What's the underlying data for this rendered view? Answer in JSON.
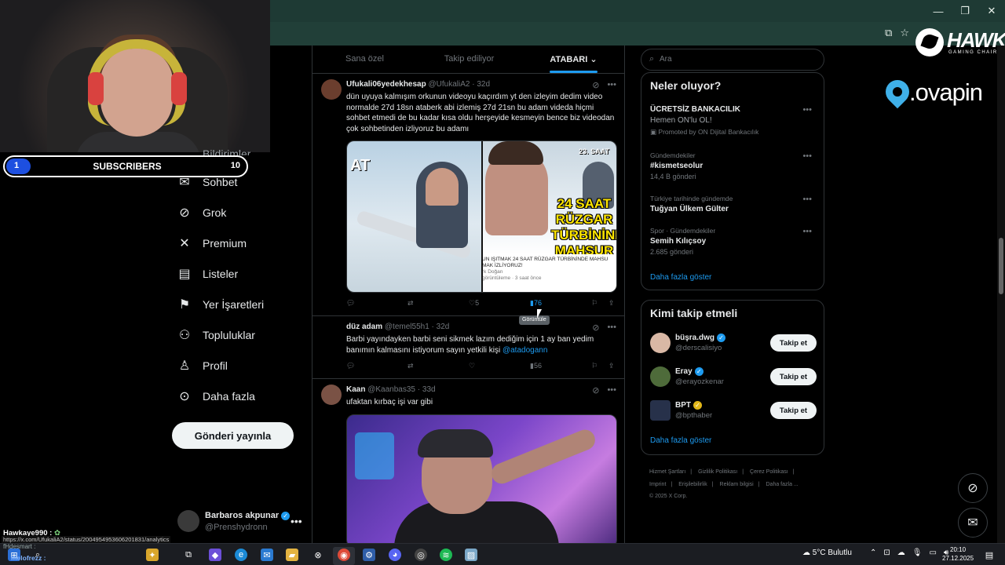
{
  "window": {
    "minimize": "—",
    "maximize": "❐",
    "close": "✕"
  },
  "subs": {
    "current": "1",
    "label": "SUBSCRIBERS",
    "goal": "10",
    "progress": 0.1
  },
  "nav": {
    "cut_item": "Bildirimler",
    "items": [
      {
        "label": "Sohbet",
        "icon": "chat-icon"
      },
      {
        "label": "Grok",
        "icon": "grok-icon"
      },
      {
        "label": "Premium",
        "icon": "x-logo-icon"
      },
      {
        "label": "Listeler",
        "icon": "list-icon"
      },
      {
        "label": "Yer İşaretleri",
        "icon": "bookmark-icon"
      },
      {
        "label": "Topluluklar",
        "icon": "communities-icon"
      },
      {
        "label": "Profil",
        "icon": "profile-icon"
      },
      {
        "label": "Daha fazla",
        "icon": "more-circle-icon"
      }
    ],
    "post_button": "Gönderi yayınla"
  },
  "account": {
    "name": "Barbaros akpunar",
    "handle": "@Prenshydronn"
  },
  "tabs": [
    "Sana özel",
    "Takip ediliyor",
    "ATABARI ⌄"
  ],
  "tweets": [
    {
      "name": "Ufukali06yedekhesap",
      "handle": "@UfukaliA2",
      "time": "· 32d",
      "text": "dün uyuya kalmışım orkunun videoyu kaçırdım yt den izleyim dedim video normalde 27d 18sn ataberk abi izlemiş 27d 21sn bu adam videda hiçmi sohbet etmedi de bu kadar kısa oldu herşeyide kesmeyin bence biz videodan çok sohbetinden izliyoruz bu adamı",
      "likes": "5",
      "views": "76",
      "thumb": {
        "left_text": "AT",
        "saat": "23. SAAT",
        "headline": "24 SAAT RÜZGAR TÜRBİNİNDE MAHSUR KALM İZLİYORUZ!",
        "info_title": "UN IŞITMAK 24 SAAT RÜZGAR TÜRBİNİNDE MAHSU MAK İZLİYORUZ!",
        "info_channel": "rk Doğan",
        "info_meta": "görüntüleme · 3 saat önce"
      }
    },
    {
      "name": "düz adam",
      "handle": "@temel55h1",
      "time": "· 32d",
      "text": "Barbi yayındayken barbi seni sikmek lazım dediğim için 1 ay ban yedim banımın kalmasını istiyorum sayın yetkili kişi",
      "mention": "@atadogann",
      "views": "56"
    },
    {
      "name": "Kaan",
      "handle": "@Kaanbas35",
      "time": "· 33d",
      "text": "ufaktan kırbaç işi var gibi"
    }
  ],
  "tooltip": "Görüntüle",
  "search": {
    "placeholder": "Ara"
  },
  "trends": {
    "title": "Neler oluyor?",
    "items": [
      {
        "meta": "",
        "title": "ÜCRETSİZ BANKACILIK",
        "sub": "Hemen ON'lu OL!",
        "promo": "Promoted by ON Dijital Bankacılık"
      },
      {
        "meta": "Gündemdekiler",
        "title": "#kismetseolur",
        "sub": "14,4 B gönderi"
      },
      {
        "meta": "Türkiye tarihinde gündemde",
        "title": "Tuğyan Ülkem Gülter",
        "sub": ""
      },
      {
        "meta": "Spor · Gündemdekiler",
        "title": "Semih Kılıçsoy",
        "sub": "2.685 gönderi"
      }
    ],
    "show_more": "Daha fazla göster"
  },
  "who_to_follow": {
    "title": "Kimi takip etmeli",
    "items": [
      {
        "name": "büşra.dwg",
        "handle": "@derscalisiyo",
        "badge": "blue",
        "avatar_color": "#d9b8a5"
      },
      {
        "name": "Eray",
        "handle": "@erayozkenar",
        "badge": "blue",
        "avatar_color": "#4e6b3a"
      },
      {
        "name": "BPT",
        "handle": "@bpthaber",
        "badge": "gold",
        "avatar_color": "#27314a"
      }
    ],
    "follow_label": "Takip et",
    "show_more": "Daha fazla göster"
  },
  "footer": [
    "Hizmet Şartları",
    "|",
    "Gizlilik Politikası",
    "|",
    "Çerez Politikası",
    "|",
    "Imprint",
    "|",
    "Erişilebilirlik",
    "|",
    "Reklam bilgisi",
    "|",
    "Daha fazla ...",
    "© 2025 X Corp."
  ],
  "overlay": {
    "hawk": "HAWK",
    "hawk_sub": "GAMING CHAIR",
    "ovapin": ".ovapin"
  },
  "chat": {
    "line1": "Hawkaye990 :",
    "status_url": "https://x.com/UfukaliA2/status/2004954953606201831/analytics",
    "line2": "fHdesmart :",
    "line3": "melofrezz :"
  },
  "taskbar": {
    "weather": "5°C Bulutlu",
    "time": "20:10",
    "date": "27.12.2025"
  },
  "colors": {
    "accent": "#1d9bf0",
    "bg": "#000000",
    "border": "#2f3336"
  }
}
